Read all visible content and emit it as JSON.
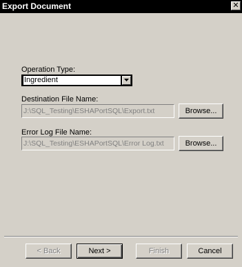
{
  "window": {
    "title": "Export Document",
    "close_glyph": "✕"
  },
  "form": {
    "operation_type_label": "Operation Type:",
    "operation_type_value": "Ingredient",
    "destination_label": "Destination File Name:",
    "destination_value": "J:\\SQL_Testing\\ESHAPortSQL\\Export.txt",
    "destination_browse": "Browse...",
    "error_log_label": "Error Log File Name:",
    "error_log_value": "J:\\SQL_Testing\\ESHAPortSQL\\Error Log.txt",
    "error_log_browse": "Browse..."
  },
  "buttons": {
    "back": "< Back",
    "next": "Next >",
    "finish": "Finish",
    "cancel": "Cancel"
  },
  "icons": {
    "close": "close-icon",
    "dropdown": "chevron-down-icon"
  }
}
